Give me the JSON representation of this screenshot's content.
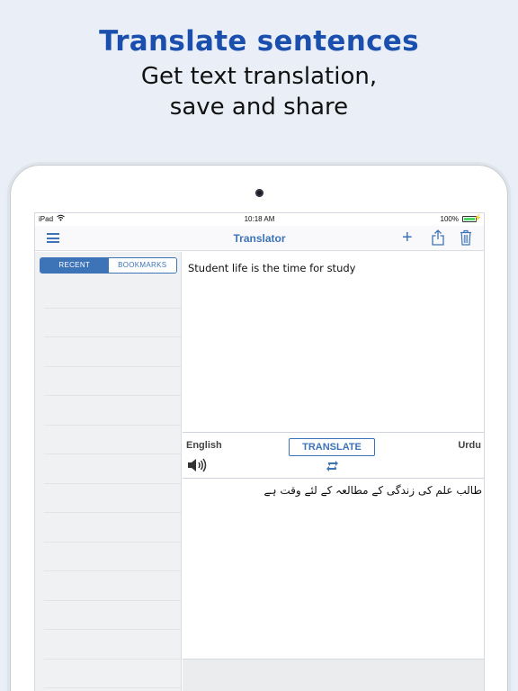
{
  "promo": {
    "headline": "Translate sentences",
    "line1": "Get text translation,",
    "line2": "save and share"
  },
  "status_bar": {
    "carrier": "iPad",
    "time": "10:18 AM",
    "battery": "100%"
  },
  "nav": {
    "title": "Translator",
    "icons": [
      "menu-icon",
      "plus-icon",
      "share-icon",
      "trash-icon"
    ]
  },
  "sidebar": {
    "tabs": [
      {
        "label": "RECENT",
        "active": true
      },
      {
        "label": "BOOKMARKS",
        "active": false
      }
    ]
  },
  "translator": {
    "source_text": "Student life is the time for study",
    "source_language": "English",
    "target_language": "Urdu",
    "translate_label": "TRANSLATE",
    "result_text": "طالب علم کی زندگی کے مطالعہ کے لئے وقت ہے"
  },
  "colors": {
    "accent": "#3d73b7",
    "headline": "#1b4fae",
    "background": "#e9eef7"
  }
}
